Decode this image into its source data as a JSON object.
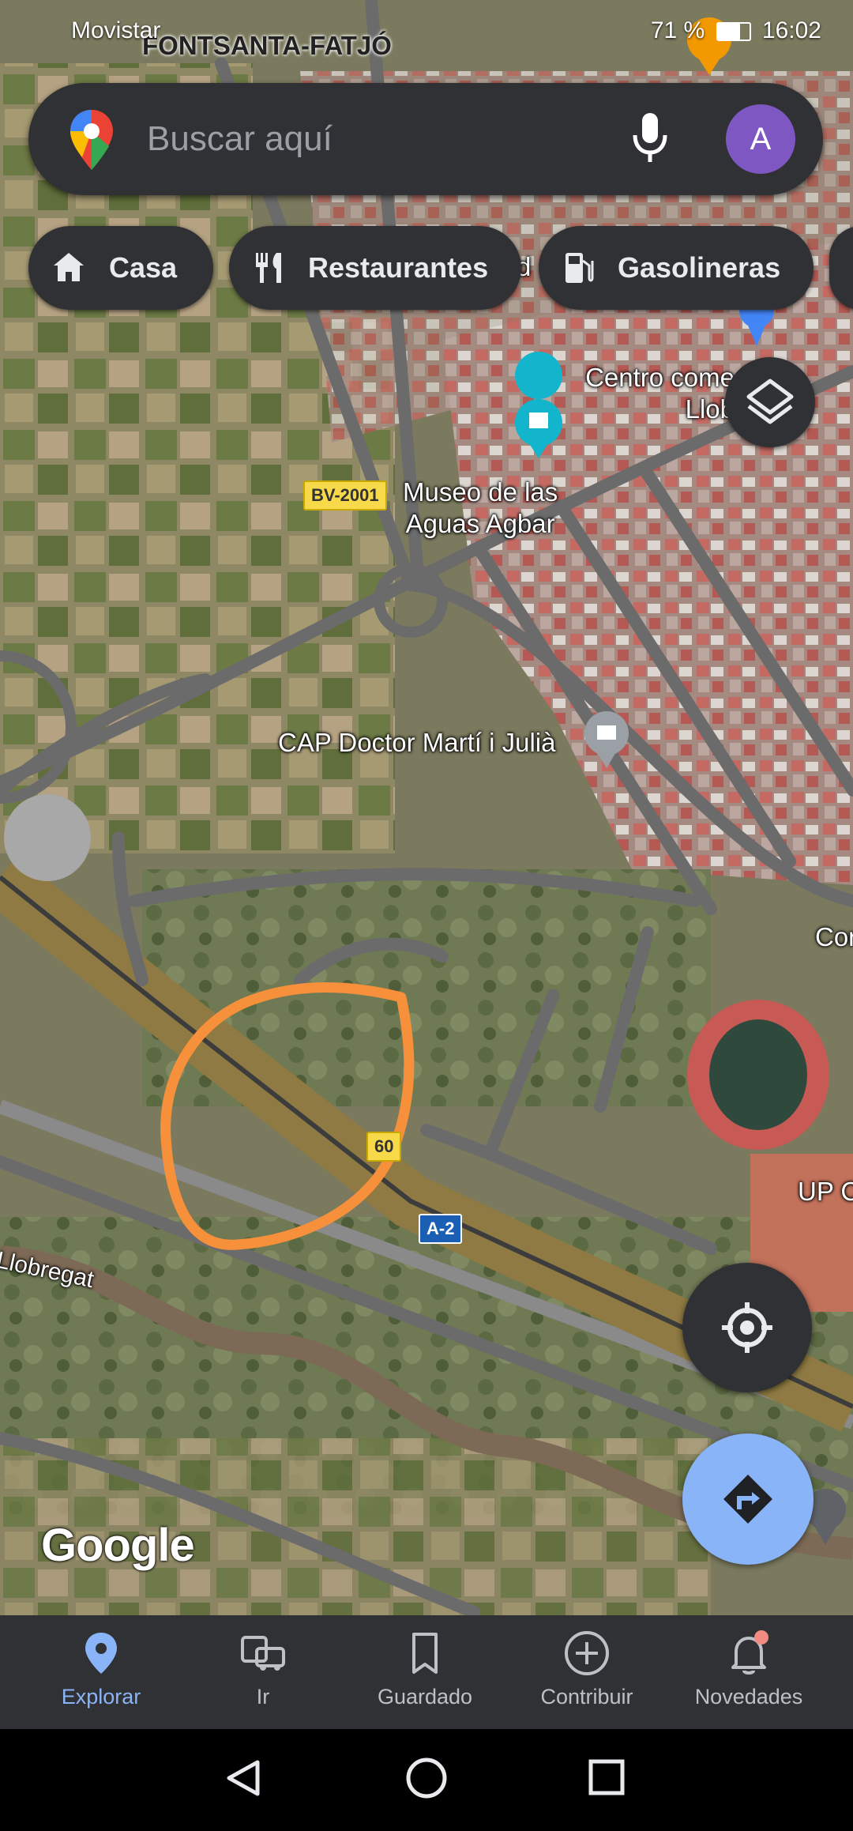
{
  "status_bar": {
    "carrier": "Movistar",
    "battery": "71 %",
    "time": "16:02"
  },
  "search": {
    "placeholder": "Buscar aquí",
    "avatar_letter": "A"
  },
  "chips": [
    {
      "label": "Casa",
      "icon": "home-icon"
    },
    {
      "label": "Restaurantes",
      "icon": "fork-knife-icon"
    },
    {
      "label": "Gasolineras",
      "icon": "fuel-icon"
    }
  ],
  "map": {
    "labels": {
      "district": "FONTSANTA-FATJÓ",
      "museum": "Museo de las\nAguas Agbar",
      "mall": "Centro come\nLlob",
      "clinic": "CAP Doctor Martí i Julià",
      "river": "Llobregat",
      "edge_right_1": "Cor",
      "edge_right_2": "UP C",
      "poi_partial": "d"
    },
    "road_shields": {
      "bv2001": "BV-2001",
      "a2": "A-2",
      "sixty": "60"
    },
    "watermark": "Google"
  },
  "bottom_nav": [
    {
      "label": "Explorar",
      "icon": "explore-pin-icon",
      "active": true
    },
    {
      "label": "Ir",
      "icon": "commute-icon",
      "active": false
    },
    {
      "label": "Guardado",
      "icon": "bookmark-icon",
      "active": false
    },
    {
      "label": "Contribuir",
      "icon": "add-circle-icon",
      "active": false
    },
    {
      "label": "Novedades",
      "icon": "bell-icon",
      "active": false
    }
  ],
  "colors": {
    "accent": "#8ab4f8",
    "chip_bg": "#303134",
    "fab_directions": "#8ab4f8",
    "avatar": "#7e57c2",
    "annotation": "#f7903a"
  }
}
